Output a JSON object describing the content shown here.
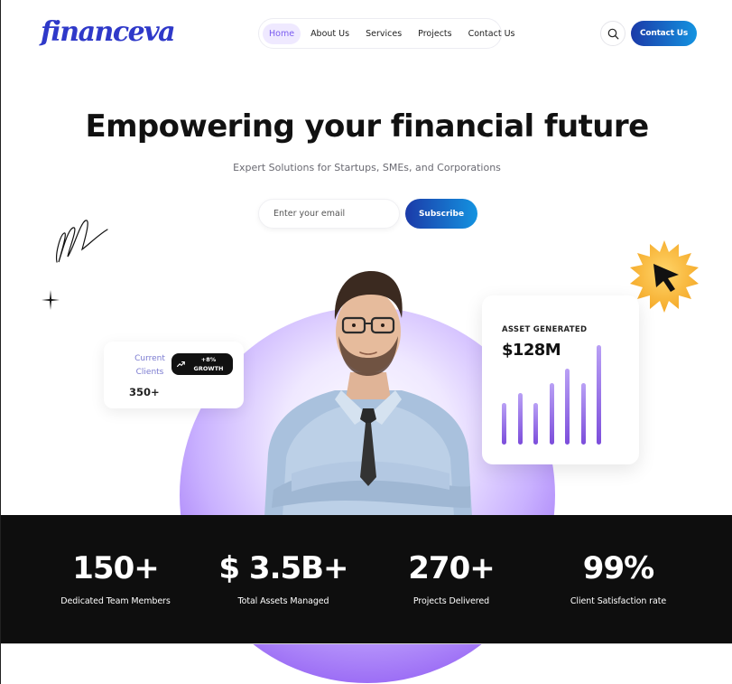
{
  "brand": {
    "logo_text": "financeva",
    "accent_color": "#2f39c9",
    "cta_gradient": [
      "#1b3aa8",
      "#1493e0"
    ],
    "purple": "#8a55f0"
  },
  "nav": {
    "items": [
      {
        "label": "Home",
        "active": true
      },
      {
        "label": "About Us",
        "active": false
      },
      {
        "label": "Services",
        "active": false
      },
      {
        "label": "Projects",
        "active": false
      },
      {
        "label": "Contact Us",
        "active": false
      }
    ]
  },
  "header": {
    "search_icon": "search-icon",
    "contact_button": "Contact Us"
  },
  "hero": {
    "title": "Empowering your financial future",
    "subtitle": "Expert Solutions for Startups, SMEs, and Corporations",
    "email_placeholder": "Enter your email",
    "subscribe_label": "Subscribe"
  },
  "clients_card": {
    "label": "Current Clients",
    "value": "350+",
    "growth_badge": "+8% GROWTH",
    "growth_icon": "trend-up-icon"
  },
  "asset_card": {
    "label": "ASSET GENERATED",
    "value": "$128M",
    "bars": [
      0.42,
      0.52,
      0.42,
      0.62,
      0.76,
      0.62,
      1.0
    ]
  },
  "stats": [
    {
      "value": "150+",
      "label": "Dedicated Team Members"
    },
    {
      "value": "$ 3.5B+",
      "label": "Total Assets Managed"
    },
    {
      "value": "270+",
      "label": "Projects Delivered"
    },
    {
      "value": "99%",
      "label": "Client Satisfaction rate"
    }
  ]
}
